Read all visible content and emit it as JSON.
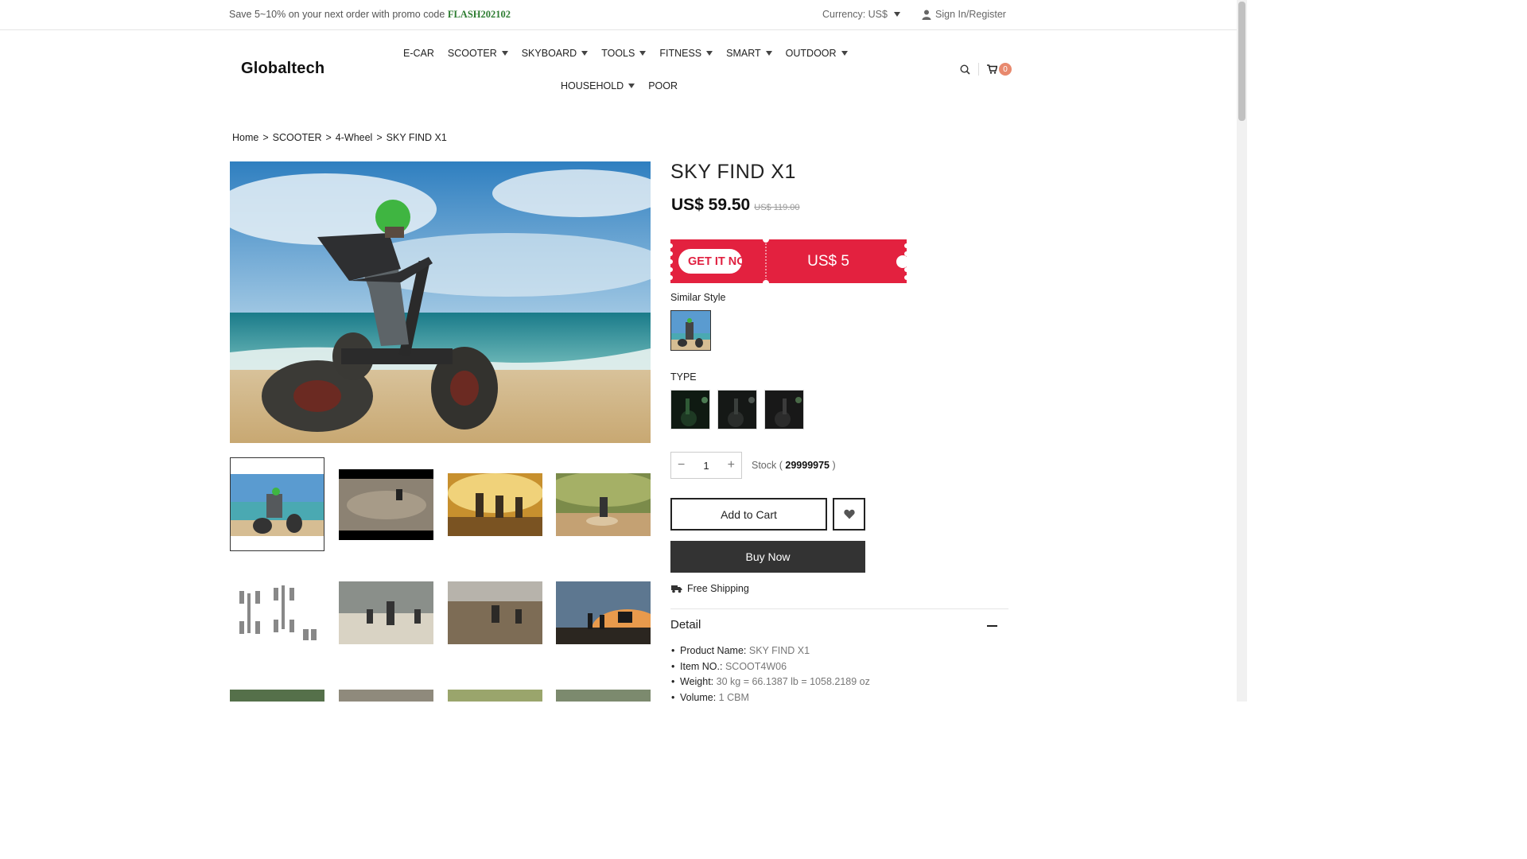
{
  "topbar": {
    "promo_text": "Save 5~10% on your next order with promo code",
    "promo_code": "FLASH202102",
    "currency_label": "Currency: US$",
    "signin_label": "Sign In/Register"
  },
  "header": {
    "logo": "Globaltech",
    "nav_row1": [
      "E-CAR",
      "SCOOTER",
      "SKYBOARD",
      "TOOLS",
      "FITNESS",
      "SMART",
      "OUTDOOR"
    ],
    "nav_row2": [
      "HOUSEHOLD",
      "POOR"
    ],
    "cart_count": "0"
  },
  "breadcrumb": [
    "Home",
    "SCOOTER",
    "4-Wheel",
    "SKY FIND X1"
  ],
  "breadcrumb_sep": ">",
  "product": {
    "title": "SKY FIND X1",
    "price": "US$ 59.50",
    "old_price": "US$ 119.00",
    "coupon_button": "GET IT NOW",
    "coupon_amount": "US$ 5",
    "similar_label": "Similar Style",
    "type_label": "TYPE",
    "quantity": "1",
    "stock_label": "Stock (",
    "stock_value": "29999975",
    "stock_close": ")",
    "add_to_cart": "Add to Cart",
    "buy_now": "Buy Now",
    "shipping": "Free Shipping",
    "detail_title": "Detail",
    "specs": [
      {
        "key": "Product Name:",
        "value": "SKY FIND X1"
      },
      {
        "key": "Item NO.:",
        "value": "SCOOT4W06"
      },
      {
        "key": "Weight:",
        "value": "30 kg = 66.1387 lb = 1058.2189 oz"
      },
      {
        "key": "Volume:",
        "value": "1 CBM"
      }
    ]
  },
  "colors": {
    "coupon_red": "#e3213f",
    "promo_green": "#2e7d32",
    "badge": "#e8896e"
  }
}
